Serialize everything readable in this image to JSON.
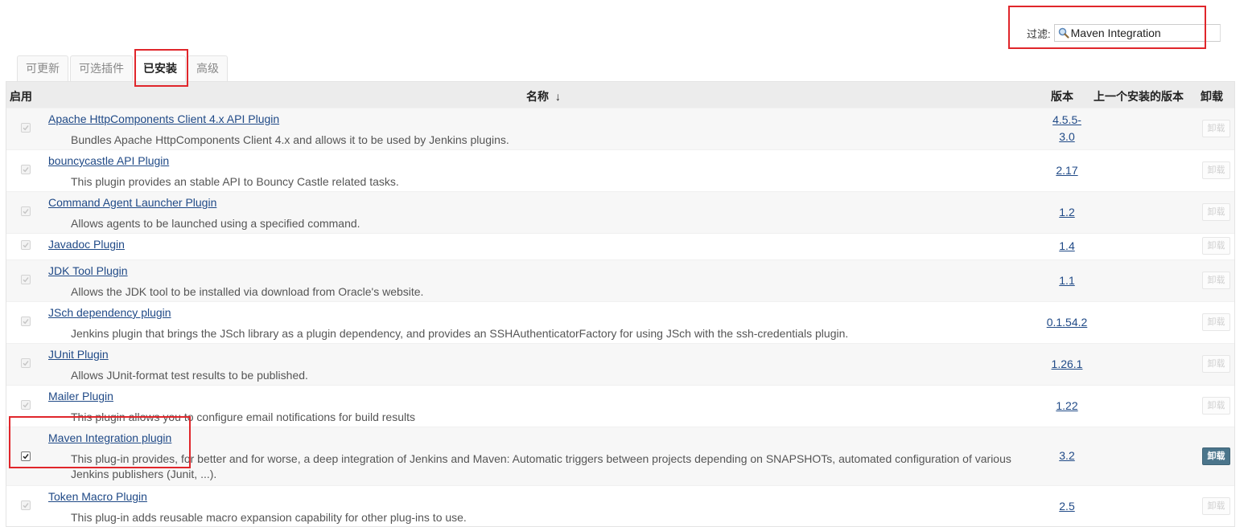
{
  "filter": {
    "label": "过滤:",
    "value": "Maven Integration"
  },
  "tabs": [
    {
      "label": "可更新"
    },
    {
      "label": "可选插件"
    },
    {
      "label": "已安装"
    },
    {
      "label": "高级"
    }
  ],
  "table": {
    "headers": {
      "enabled": "启用",
      "name": "名称",
      "sort_arrow": "↓",
      "version": "版本",
      "previous": "上一个安装的版本",
      "uninstall": "卸载"
    },
    "rows": [
      {
        "name": "Apache HttpComponents Client 4.x API Plugin",
        "desc": "Bundles Apache HttpComponents Client 4.x and allows it to be used by Jenkins plugins.",
        "version_line1": "4.5.5-",
        "version_line2": "3.0",
        "enabled": true,
        "can_uninstall": false,
        "uninstall_label": "卸载"
      },
      {
        "name": "bouncycastle API Plugin",
        "desc": "This plugin provides an stable API to Bouncy Castle related tasks.",
        "version_line1": "2.17",
        "enabled": true,
        "can_uninstall": false,
        "uninstall_label": "卸载"
      },
      {
        "name": "Command Agent Launcher Plugin",
        "desc": "Allows agents to be launched using a specified command.",
        "version_line1": "1.2",
        "enabled": true,
        "can_uninstall": false,
        "uninstall_label": "卸载"
      },
      {
        "name": "Javadoc Plugin",
        "desc": "",
        "version_line1": "1.4",
        "enabled": true,
        "can_uninstall": false,
        "uninstall_label": "卸载"
      },
      {
        "name": "JDK Tool Plugin",
        "desc": "Allows the JDK tool to be installed via download from Oracle's website.",
        "version_line1": "1.1",
        "enabled": true,
        "can_uninstall": false,
        "uninstall_label": "卸载"
      },
      {
        "name": "JSch dependency plugin",
        "desc": "Jenkins plugin that brings the JSch library as a plugin dependency, and provides an SSHAuthenticatorFactory for using JSch with the ssh-credentials plugin.",
        "version_line1": "0.1.54.2",
        "enabled": true,
        "can_uninstall": false,
        "uninstall_label": "卸载"
      },
      {
        "name": "JUnit Plugin",
        "desc": "Allows JUnit-format test results to be published.",
        "version_line1": "1.26.1",
        "enabled": true,
        "can_uninstall": false,
        "uninstall_label": "卸载"
      },
      {
        "name": "Mailer Plugin",
        "desc": "This plugin allows you to configure email notifications for build results",
        "version_line1": "1.22",
        "enabled": true,
        "can_uninstall": false,
        "uninstall_label": "卸载"
      },
      {
        "name": "Maven Integration plugin",
        "desc": "This plug-in provides, for better and for worse, a deep integration of Jenkins and Maven: Automatic triggers between projects depending on SNAPSHOTs, automated configuration of various Jenkins publishers (Junit, ...).",
        "version_line1": "3.2",
        "enabled": true,
        "can_uninstall": true,
        "uninstall_label": "卸载"
      },
      {
        "name": "Token Macro Plugin",
        "desc": "This plug-in adds reusable macro expansion capability for other plug-ins to use.",
        "version_line1": "2.5",
        "enabled": true,
        "can_uninstall": false,
        "uninstall_label": "卸载"
      }
    ]
  },
  "colors": {
    "highlight": "#e0262b",
    "link": "#204a87",
    "uninstall_active": "#4b758b"
  }
}
